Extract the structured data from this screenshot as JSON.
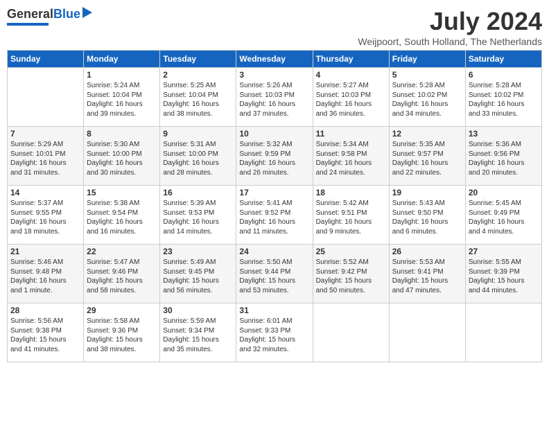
{
  "header": {
    "logo_general": "General",
    "logo_blue": "Blue",
    "month_title": "July 2024",
    "location": "Weijpoort, South Holland, The Netherlands"
  },
  "days_of_week": [
    "Sunday",
    "Monday",
    "Tuesday",
    "Wednesday",
    "Thursday",
    "Friday",
    "Saturday"
  ],
  "weeks": [
    [
      {
        "num": "",
        "info": ""
      },
      {
        "num": "1",
        "info": "Sunrise: 5:24 AM\nSunset: 10:04 PM\nDaylight: 16 hours\nand 39 minutes."
      },
      {
        "num": "2",
        "info": "Sunrise: 5:25 AM\nSunset: 10:04 PM\nDaylight: 16 hours\nand 38 minutes."
      },
      {
        "num": "3",
        "info": "Sunrise: 5:26 AM\nSunset: 10:03 PM\nDaylight: 16 hours\nand 37 minutes."
      },
      {
        "num": "4",
        "info": "Sunrise: 5:27 AM\nSunset: 10:03 PM\nDaylight: 16 hours\nand 36 minutes."
      },
      {
        "num": "5",
        "info": "Sunrise: 5:28 AM\nSunset: 10:02 PM\nDaylight: 16 hours\nand 34 minutes."
      },
      {
        "num": "6",
        "info": "Sunrise: 5:28 AM\nSunset: 10:02 PM\nDaylight: 16 hours\nand 33 minutes."
      }
    ],
    [
      {
        "num": "7",
        "info": "Sunrise: 5:29 AM\nSunset: 10:01 PM\nDaylight: 16 hours\nand 31 minutes."
      },
      {
        "num": "8",
        "info": "Sunrise: 5:30 AM\nSunset: 10:00 PM\nDaylight: 16 hours\nand 30 minutes."
      },
      {
        "num": "9",
        "info": "Sunrise: 5:31 AM\nSunset: 10:00 PM\nDaylight: 16 hours\nand 28 minutes."
      },
      {
        "num": "10",
        "info": "Sunrise: 5:32 AM\nSunset: 9:59 PM\nDaylight: 16 hours\nand 26 minutes."
      },
      {
        "num": "11",
        "info": "Sunrise: 5:34 AM\nSunset: 9:58 PM\nDaylight: 16 hours\nand 24 minutes."
      },
      {
        "num": "12",
        "info": "Sunrise: 5:35 AM\nSunset: 9:57 PM\nDaylight: 16 hours\nand 22 minutes."
      },
      {
        "num": "13",
        "info": "Sunrise: 5:36 AM\nSunset: 9:56 PM\nDaylight: 16 hours\nand 20 minutes."
      }
    ],
    [
      {
        "num": "14",
        "info": "Sunrise: 5:37 AM\nSunset: 9:55 PM\nDaylight: 16 hours\nand 18 minutes."
      },
      {
        "num": "15",
        "info": "Sunrise: 5:38 AM\nSunset: 9:54 PM\nDaylight: 16 hours\nand 16 minutes."
      },
      {
        "num": "16",
        "info": "Sunrise: 5:39 AM\nSunset: 9:53 PM\nDaylight: 16 hours\nand 14 minutes."
      },
      {
        "num": "17",
        "info": "Sunrise: 5:41 AM\nSunset: 9:52 PM\nDaylight: 16 hours\nand 11 minutes."
      },
      {
        "num": "18",
        "info": "Sunrise: 5:42 AM\nSunset: 9:51 PM\nDaylight: 16 hours\nand 9 minutes."
      },
      {
        "num": "19",
        "info": "Sunrise: 5:43 AM\nSunset: 9:50 PM\nDaylight: 16 hours\nand 6 minutes."
      },
      {
        "num": "20",
        "info": "Sunrise: 5:45 AM\nSunset: 9:49 PM\nDaylight: 16 hours\nand 4 minutes."
      }
    ],
    [
      {
        "num": "21",
        "info": "Sunrise: 5:46 AM\nSunset: 9:48 PM\nDaylight: 16 hours\nand 1 minute."
      },
      {
        "num": "22",
        "info": "Sunrise: 5:47 AM\nSunset: 9:46 PM\nDaylight: 15 hours\nand 58 minutes."
      },
      {
        "num": "23",
        "info": "Sunrise: 5:49 AM\nSunset: 9:45 PM\nDaylight: 15 hours\nand 56 minutes."
      },
      {
        "num": "24",
        "info": "Sunrise: 5:50 AM\nSunset: 9:44 PM\nDaylight: 15 hours\nand 53 minutes."
      },
      {
        "num": "25",
        "info": "Sunrise: 5:52 AM\nSunset: 9:42 PM\nDaylight: 15 hours\nand 50 minutes."
      },
      {
        "num": "26",
        "info": "Sunrise: 5:53 AM\nSunset: 9:41 PM\nDaylight: 15 hours\nand 47 minutes."
      },
      {
        "num": "27",
        "info": "Sunrise: 5:55 AM\nSunset: 9:39 PM\nDaylight: 15 hours\nand 44 minutes."
      }
    ],
    [
      {
        "num": "28",
        "info": "Sunrise: 5:56 AM\nSunset: 9:38 PM\nDaylight: 15 hours\nand 41 minutes."
      },
      {
        "num": "29",
        "info": "Sunrise: 5:58 AM\nSunset: 9:36 PM\nDaylight: 15 hours\nand 38 minutes."
      },
      {
        "num": "30",
        "info": "Sunrise: 5:59 AM\nSunset: 9:34 PM\nDaylight: 15 hours\nand 35 minutes."
      },
      {
        "num": "31",
        "info": "Sunrise: 6:01 AM\nSunset: 9:33 PM\nDaylight: 15 hours\nand 32 minutes."
      },
      {
        "num": "",
        "info": ""
      },
      {
        "num": "",
        "info": ""
      },
      {
        "num": "",
        "info": ""
      }
    ]
  ]
}
